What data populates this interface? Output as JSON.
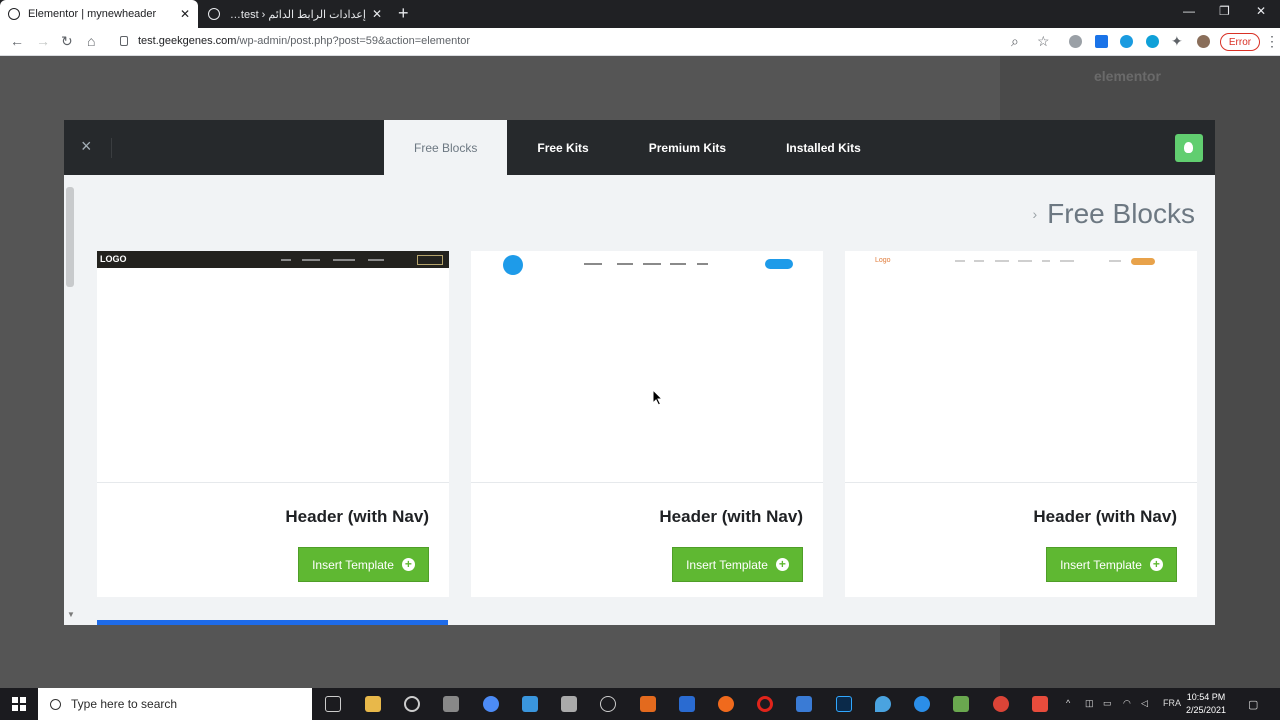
{
  "browser": {
    "tabs": [
      {
        "title": "Elementor | mynewheader",
        "active": true
      },
      {
        "title": "إعدادات الرابط الدائم ‹ test — ورد",
        "active": false
      }
    ],
    "new_tab": "+",
    "url_host": "test.geekgenes.com",
    "url_path": "/wp-admin/post.php?post=59&action=elementor",
    "error_label": "Error"
  },
  "editor": {
    "logo": "elementor"
  },
  "modal": {
    "close": "×",
    "tabs": [
      "Free Blocks",
      "Free Kits",
      "Premium Kits",
      "Installed Kits"
    ],
    "active_tab": "Free Blocks",
    "breadcrumb": "Free Blocks",
    "cards": [
      {
        "title": "Header (with Nav)",
        "button": "Insert Template",
        "preview_logo": "LOGO"
      },
      {
        "title": "Header (with Nav)",
        "button": "Insert Template",
        "preview_logo": ""
      },
      {
        "title": "Header (with Nav)",
        "button": "Insert Template",
        "preview_logo": "Logo"
      }
    ]
  },
  "taskbar": {
    "search_placeholder": "Type here to search",
    "time": "10:54 PM",
    "date": "2/25/2021",
    "language": "FRA"
  },
  "colors": {
    "accent_green": "#5fb832",
    "modal_header": "#26292c",
    "brand_blue": "#1e9be9"
  }
}
